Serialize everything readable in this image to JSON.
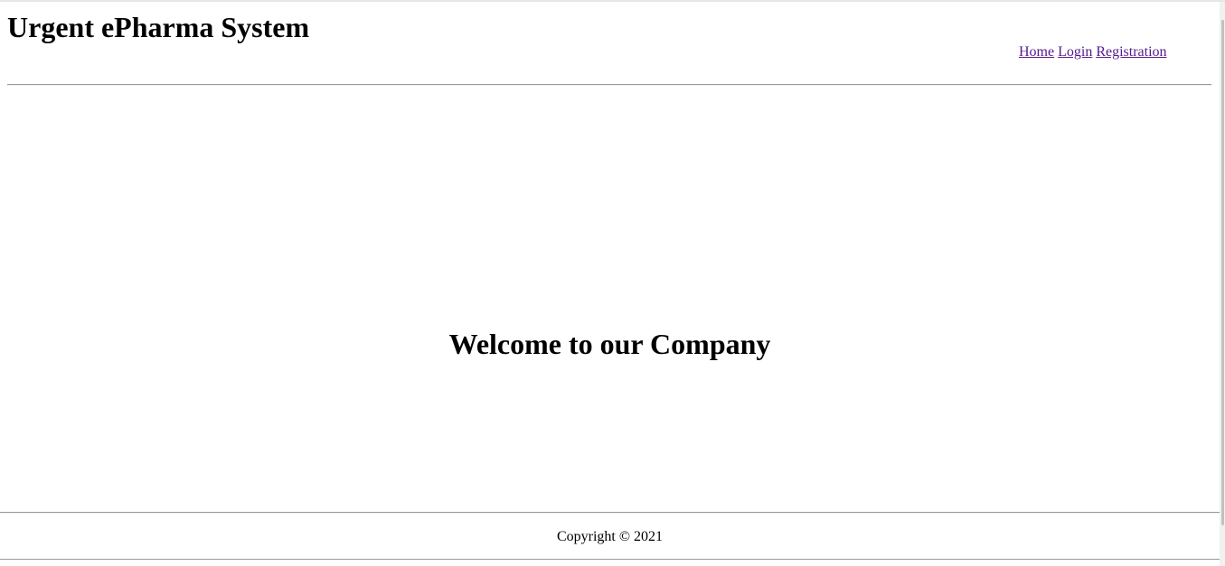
{
  "header": {
    "title": "Urgent ePharma System",
    "nav": {
      "home": "Home",
      "login": "Login",
      "registration": "Registration"
    }
  },
  "main": {
    "welcome": "Welcome to our Company"
  },
  "footer": {
    "copyright": "Copyright © 2021"
  },
  "colors": {
    "link_visited": "#551a8b",
    "rule": "#9a9a9a"
  }
}
